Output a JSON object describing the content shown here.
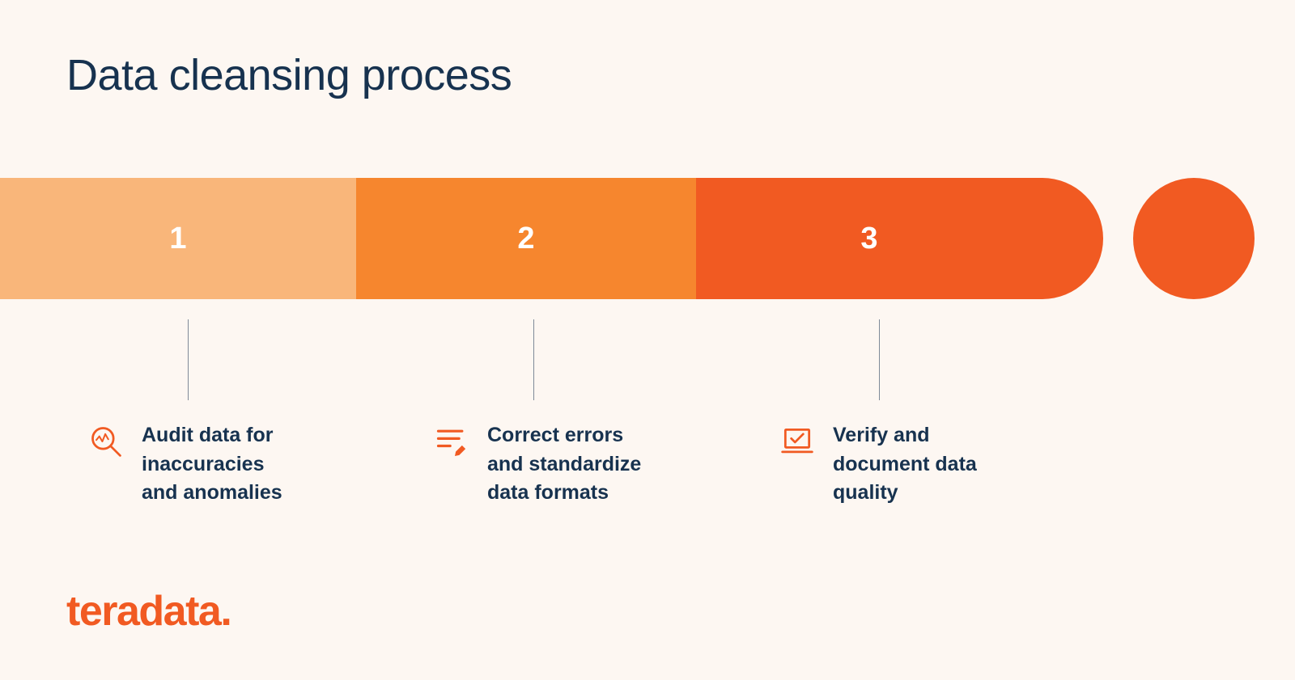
{
  "title": "Data cleansing process",
  "colors": {
    "bg": "#fdf7f2",
    "text": "#17324f",
    "seg1": "#f9b67a",
    "seg2": "#f6862e",
    "seg3": "#f15a22",
    "brand": "#f15a22"
  },
  "steps": [
    {
      "num": "1",
      "icon": "audit-magnifier-icon",
      "label": "Audit data for\ninaccuracies\nand anomalies"
    },
    {
      "num": "2",
      "icon": "edit-lines-icon",
      "label": "Correct errors\nand standardize\ndata formats"
    },
    {
      "num": "3",
      "icon": "laptop-check-icon",
      "label": "Verify and\ndocument data\nquality"
    }
  ],
  "brand": "teradata."
}
